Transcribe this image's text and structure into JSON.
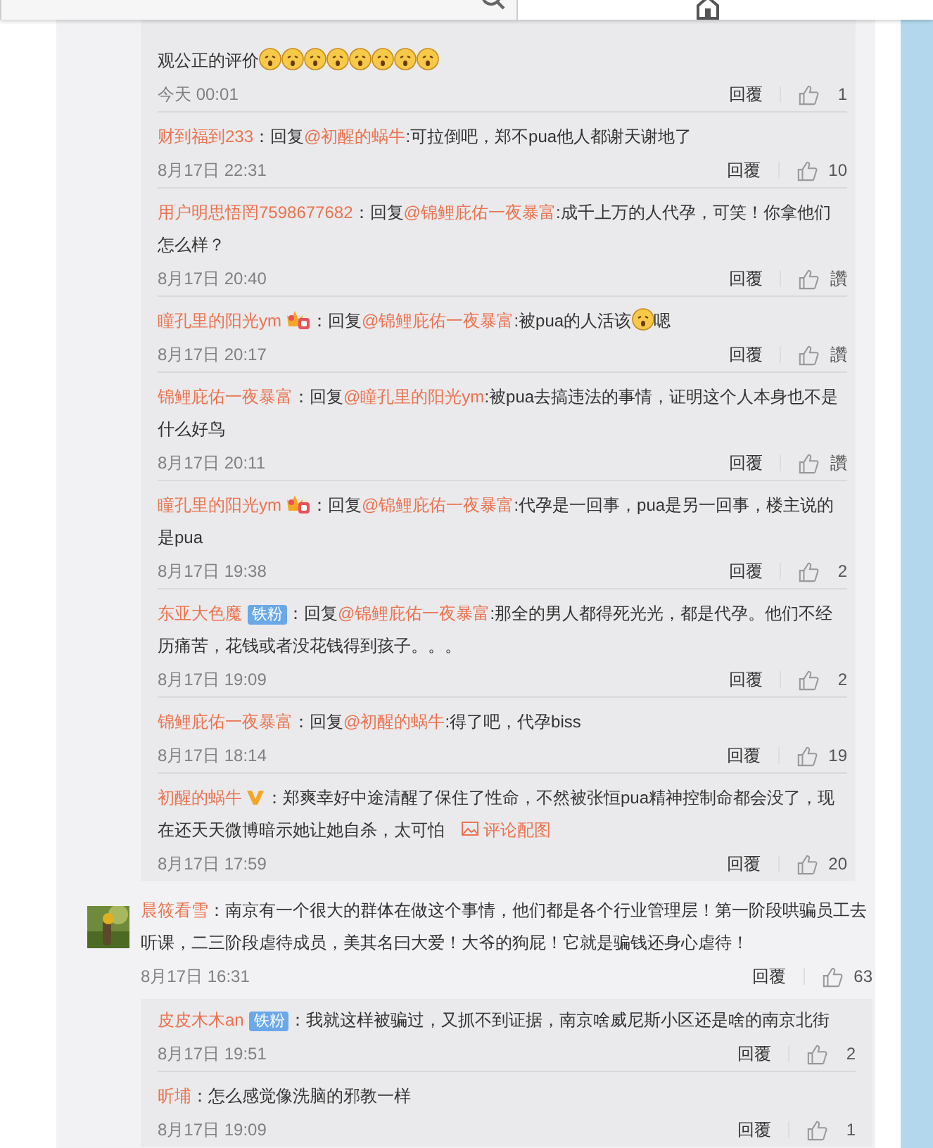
{
  "threads": [
    {
      "replies": [
        {
          "segments": [
            {
              "kind": "plain",
              "text": "观公正的评价"
            },
            {
              "kind": "emoji"
            },
            {
              "kind": "emoji"
            },
            {
              "kind": "emoji"
            },
            {
              "kind": "emoji"
            },
            {
              "kind": "emoji"
            },
            {
              "kind": "emoji"
            },
            {
              "kind": "emoji"
            },
            {
              "kind": "emoji"
            }
          ],
          "time": "今天 00:01",
          "reply": "回覆",
          "likes": "1"
        },
        {
          "author": "财到福到233",
          "segments": [
            {
              "kind": "plain",
              "text": "：回复"
            },
            {
              "kind": "mention",
              "text": "@初醒的蜗牛"
            },
            {
              "kind": "plain",
              "text": ":可拉倒吧，郑不pua他人都谢天谢地了"
            }
          ],
          "time": "8月17日 22:31",
          "reply": "回覆",
          "likes": "10"
        },
        {
          "author": "用户明思悟罔7598677682",
          "segments": [
            {
              "kind": "plain",
              "text": "：回复"
            },
            {
              "kind": "mention",
              "text": "@锦鲤庇佑一夜暴富"
            },
            {
              "kind": "plain",
              "text": ":成千上万的人代孕，可笑！你拿他们怎么样？"
            }
          ],
          "time": "8月17日 20:40",
          "reply": "回覆",
          "likes": "讚"
        },
        {
          "author": "瞳孔里的阳光ym",
          "badge": {
            "kind": "crown"
          },
          "segments": [
            {
              "kind": "plain",
              "text": "：回复"
            },
            {
              "kind": "mention",
              "text": "@锦鲤庇佑一夜暴富"
            },
            {
              "kind": "plain",
              "text": ":被pua的人活该"
            },
            {
              "kind": "emoji"
            },
            {
              "kind": "plain",
              "text": "嗯"
            }
          ],
          "time": "8月17日 20:17",
          "reply": "回覆",
          "likes": "讚"
        },
        {
          "author": "锦鲤庇佑一夜暴富",
          "segments": [
            {
              "kind": "plain",
              "text": "：回复"
            },
            {
              "kind": "mention",
              "text": "@瞳孔里的阳光ym"
            },
            {
              "kind": "plain",
              "text": ":被pua去搞违法的事情，证明这个人本身也不是什么好鸟"
            }
          ],
          "time": "8月17日 20:11",
          "reply": "回覆",
          "likes": "讚"
        },
        {
          "author": "瞳孔里的阳光ym",
          "badge": {
            "kind": "crown"
          },
          "segments": [
            {
              "kind": "plain",
              "text": "：回复"
            },
            {
              "kind": "mention",
              "text": "@锦鲤庇佑一夜暴富"
            },
            {
              "kind": "plain",
              "text": ":代孕是一回事，pua是另一回事，楼主说的是pua"
            }
          ],
          "time": "8月17日 19:38",
          "reply": "回覆",
          "likes": "2"
        },
        {
          "author": "东亚大色魔",
          "badge": {
            "kind": "fan",
            "label": "铁粉"
          },
          "segments": [
            {
              "kind": "plain",
              "text": "：回复"
            },
            {
              "kind": "mention",
              "text": "@锦鲤庇佑一夜暴富"
            },
            {
              "kind": "plain",
              "text": ":那全的男人都得死光光，都是代孕。他们不经历痛苦，花钱或者没花钱得到孩子。。。"
            }
          ],
          "time": "8月17日 19:09",
          "reply": "回覆",
          "likes": "2"
        },
        {
          "author": "锦鲤庇佑一夜暴富",
          "segments": [
            {
              "kind": "plain",
              "text": "：回复"
            },
            {
              "kind": "mention",
              "text": "@初醒的蜗牛"
            },
            {
              "kind": "plain",
              "text": ":得了吧，代孕biss"
            }
          ],
          "time": "8月17日 18:14",
          "reply": "回覆",
          "likes": "19"
        },
        {
          "author": "初醒的蜗牛",
          "badge": {
            "kind": "v"
          },
          "segments": [
            {
              "kind": "plain",
              "text": "：郑爽幸好中途清醒了保住了性命，不然被张恒pua精神控制命都会没了，现在还天天微博暗示她让她自杀，太可怕"
            },
            {
              "kind": "image_link",
              "text": "评论配图"
            }
          ],
          "time": "8月17日 17:59",
          "reply": "回覆",
          "likes": "20"
        }
      ]
    },
    {
      "comment": {
        "author": "晨筱看雪",
        "segments": [
          {
            "kind": "plain",
            "text": "：南京有一个很大的群体在做这个事情，他们都是各个行业管理层！第一阶段哄骗员工去听课，二三阶段虐待成员，美其名曰大爱！大爷的狗屁！它就是骗钱还身心虐待！"
          }
        ],
        "time": "8月17日 16:31",
        "reply": "回覆",
        "likes": "63"
      },
      "replies": [
        {
          "author": "皮皮木木an",
          "badge": {
            "kind": "fan",
            "label": "铁粉"
          },
          "segments": [
            {
              "kind": "plain",
              "text": "：我就这样被骗过，又抓不到证据，南京啥威尼斯小区还是啥的南京北街"
            }
          ],
          "time": "8月17日 19:51",
          "reply": "回覆",
          "likes": "2"
        },
        {
          "author": "昕埔",
          "segments": [
            {
              "kind": "plain",
              "text": "：怎么感觉像洗脑的邪教一样"
            }
          ],
          "time": "8月17日 19:09",
          "reply": "回覆",
          "likes": "1"
        }
      ]
    }
  ]
}
